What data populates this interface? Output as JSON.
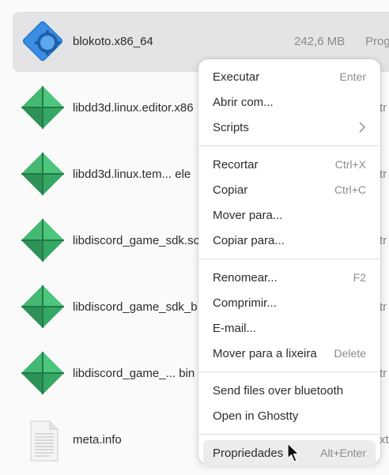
{
  "files": [
    {
      "name": "blokoto.x86_64",
      "size": "242,6 MB",
      "type": "Prog",
      "icon": "blokoto-app-icon",
      "selected": true
    },
    {
      "name": "libdd3d.linux.editor.x86",
      "size": "",
      "type": "tr",
      "icon": "godot-extension-icon"
    },
    {
      "name": "libdd3d.linux.tem...  ele",
      "size": "",
      "type": "tr",
      "icon": "godot-extension-icon"
    },
    {
      "name": "libdiscord_game_sdk.so",
      "size": "",
      "type": "tr",
      "icon": "godot-extension-icon"
    },
    {
      "name": "libdiscord_game_sdk_b",
      "size": "",
      "type": "tr",
      "icon": "godot-extension-icon"
    },
    {
      "name": "libdiscord_game_... bin",
      "size": "",
      "type": "tr",
      "icon": "godot-extension-icon"
    },
    {
      "name": "meta.info",
      "size": "",
      "type": "xt",
      "icon": "text-file-icon"
    }
  ],
  "menu": {
    "groups": [
      [
        {
          "label": "Executar",
          "shortcut": "Enter"
        },
        {
          "label": "Abrir com...",
          "shortcut": ""
        },
        {
          "label": "Scripts",
          "shortcut": "",
          "submenu": true
        }
      ],
      [
        {
          "label": "Recortar",
          "shortcut": "Ctrl+X"
        },
        {
          "label": "Copiar",
          "shortcut": "Ctrl+C"
        },
        {
          "label": "Mover para...",
          "shortcut": ""
        },
        {
          "label": "Copiar para...",
          "shortcut": ""
        }
      ],
      [
        {
          "label": "Renomear...",
          "shortcut": "F2"
        },
        {
          "label": "Comprimir...",
          "shortcut": ""
        },
        {
          "label": "E-mail...",
          "shortcut": ""
        },
        {
          "label": "Mover para a lixeira",
          "shortcut": "Delete"
        }
      ],
      [
        {
          "label": "Send files over bluetooth",
          "shortcut": ""
        },
        {
          "label": "Open in Ghostty",
          "shortcut": ""
        }
      ],
      [
        {
          "label": "Propriedades",
          "shortcut": "Alt+Enter",
          "hover": true
        }
      ]
    ]
  },
  "colors": {
    "selected_row": "#e4e4e6",
    "godot_green": "#3fb36b",
    "blokoto_blue": "#2f7fd4",
    "menu_bg": "#ffffff",
    "hover_bg": "#ececec"
  }
}
